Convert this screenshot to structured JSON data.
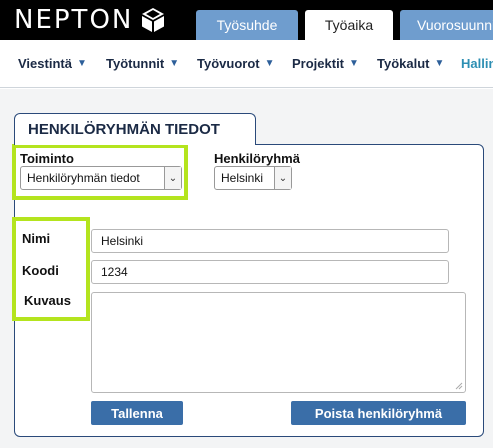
{
  "brand": {
    "name": "NEPTON"
  },
  "tabs": [
    {
      "label": "Työsuhde"
    },
    {
      "label": "Työaika"
    },
    {
      "label": "Vuorosuunnittelu"
    }
  ],
  "nav": [
    {
      "label": "Viestintä"
    },
    {
      "label": "Työtunnit"
    },
    {
      "label": "Työvuorot"
    },
    {
      "label": "Projektit"
    },
    {
      "label": "Työkalut"
    },
    {
      "label": "Hallinta"
    }
  ],
  "panel": {
    "title": "HENKILÖRYHMÄN TIEDOT",
    "action": {
      "label": "Toiminto",
      "value": "Henkilöryhmän tiedot"
    },
    "group": {
      "label": "Henkilöryhmä",
      "value": "Helsinki"
    },
    "fields": {
      "name": {
        "label": "Nimi",
        "value": "Helsinki"
      },
      "code": {
        "label": "Koodi",
        "value": "1234"
      },
      "description": {
        "label": "Kuvaus",
        "value": ""
      }
    },
    "buttons": {
      "save": "Tallenna",
      "delete": "Poista henkilöryhmä"
    }
  },
  "colors": {
    "highlight": "#b4e41e",
    "tab_inactive": "#6f9dce",
    "button": "#3a6ea8",
    "panel_border": "#2a4a7a"
  }
}
